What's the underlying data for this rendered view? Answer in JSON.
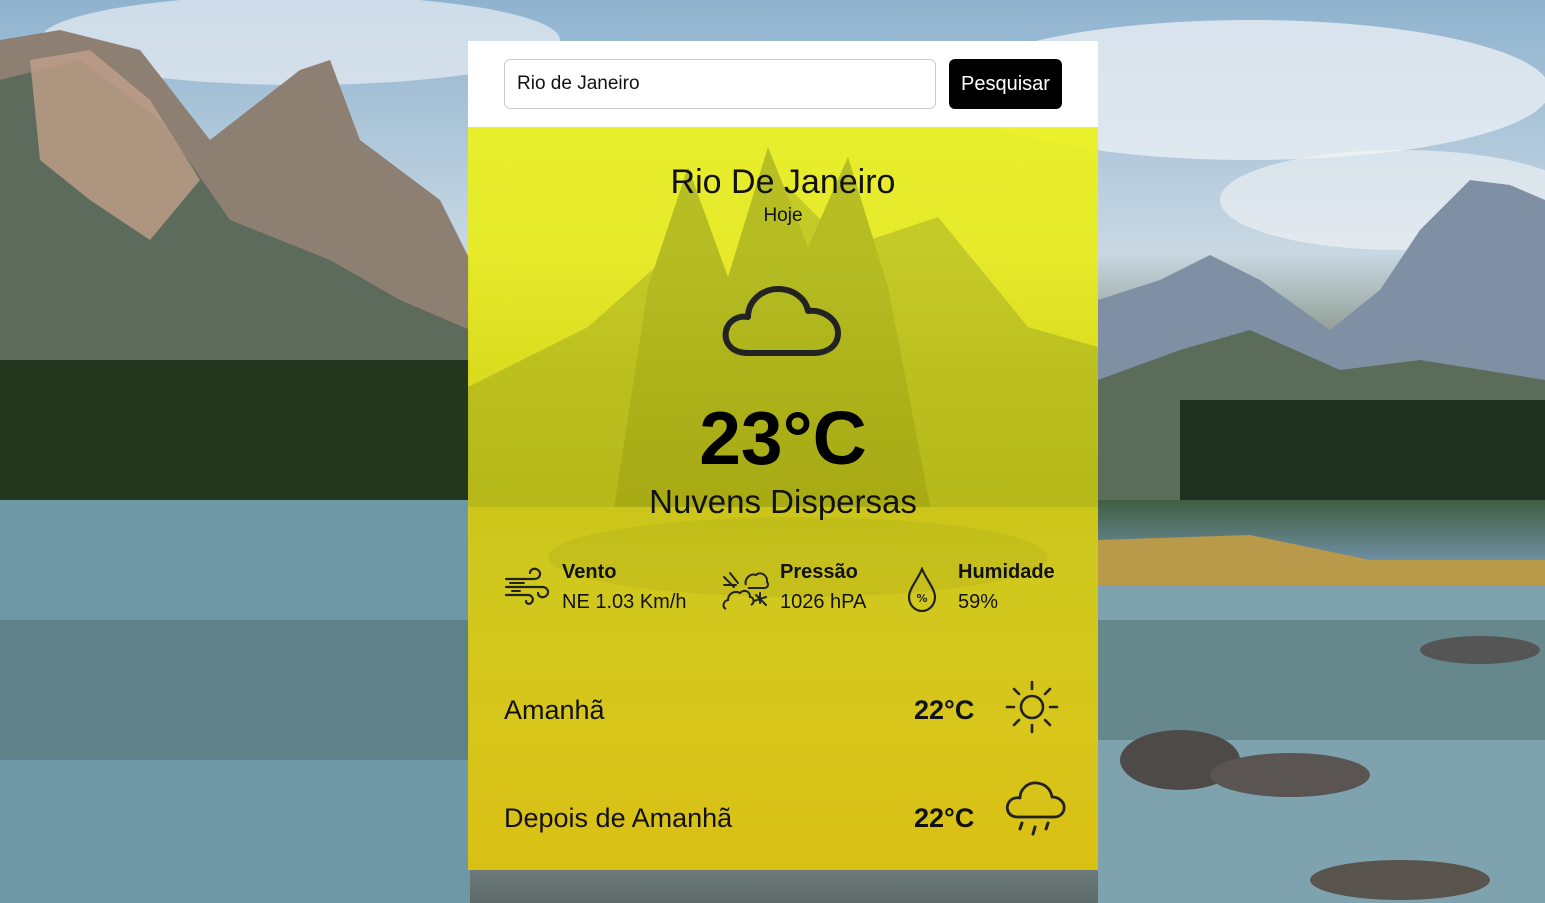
{
  "search": {
    "value": "Rio de Janeiro",
    "button_label": "Pesquisar"
  },
  "today": {
    "city": "Rio De Janeiro",
    "day_label": "Hoje",
    "icon": "cloud-icon",
    "temperature": "23°C",
    "description": "Nuvens Dispersas"
  },
  "stats": {
    "wind": {
      "label": "Vento",
      "value": "NE 1.03 Km/h",
      "icon": "wind-icon"
    },
    "pressure": {
      "label": "Pressão",
      "value": "1026 hPA",
      "icon": "pressure-icon"
    },
    "humidity": {
      "label": "Humidade",
      "value": "59%",
      "icon": "humidity-icon"
    }
  },
  "forecast": [
    {
      "day": "Amanhã",
      "temperature": "22°C",
      "icon": "sun-icon"
    },
    {
      "day": "Depois de Amanhã",
      "temperature": "22°C",
      "icon": "rain-cloud-icon"
    }
  ],
  "colors": {
    "panel_yellow": "#ecee1e",
    "button_bg": "#000000",
    "text": "#111111"
  }
}
